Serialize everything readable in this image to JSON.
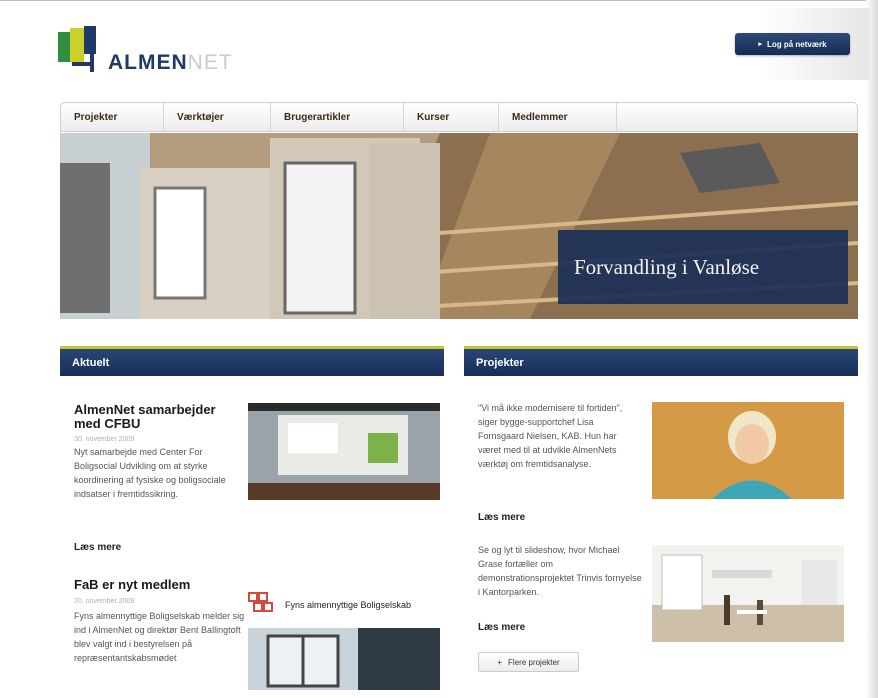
{
  "header": {
    "logo_main": "ALMEN",
    "logo_sub": "NET",
    "login_label": "Log på netværk",
    "login_icon": "arrow-right-icon"
  },
  "nav": {
    "items": [
      {
        "label": "Projekter"
      },
      {
        "label": "Værktøjer"
      },
      {
        "label": "Brugerartikler"
      },
      {
        "label": "Kurser"
      },
      {
        "label": "Medlemmer"
      }
    ]
  },
  "hero": {
    "caption": "Forvandling i Vanløse"
  },
  "aktuelt": {
    "title": "Aktuelt",
    "items": [
      {
        "title": "AlmenNet samarbejder med CFBU",
        "date": "30. november 2009",
        "text": "Nyt samarbejde med Center For Boligsocial Udvikling om at styrke koordinering af fysiske og boligsociale indsatser i fremtidssikring.",
        "more": "Læs mere"
      },
      {
        "title": "FaB er nyt medlem",
        "date": "20. november 2009",
        "text": "Fyns almennyttige Boligselskab melder sig ind i AlmenNet og direktør Bent Ballingtoft blev valgt ind i bestyrelsen på repræsentantskabsmødet",
        "logo_label": "Fyns almennyttige Boligselskab"
      }
    ]
  },
  "projekter": {
    "title": "Projekter",
    "items": [
      {
        "text": "\"Vi må ikke modernisere til fortiden\", siger bygge-supportchef Lisa Fornsgaard Nielsen, KAB. Hun har været med til at udvikle AlmenNets værktøj om fremtidsanalyse.",
        "more": "Læs mere"
      },
      {
        "text": "Se og lyt til slideshow, hvor Michael Grase fortæller om demonstrationsprojektet Trinvis fornyelse i Kantorparken.",
        "more": "Læs mere"
      }
    ],
    "more_button": "Flere projekter"
  },
  "colors": {
    "navy": "#1c2f57",
    "accent": "#c5c82b"
  }
}
